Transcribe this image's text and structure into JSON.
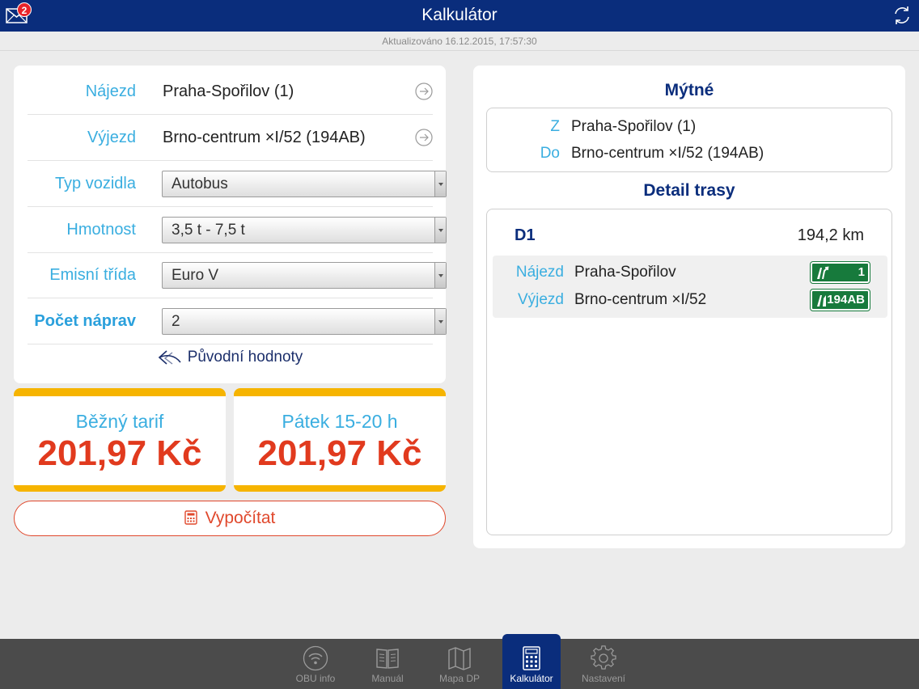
{
  "header": {
    "title": "Kalkulátor",
    "mail_badge": "2",
    "updated": "Aktualizováno 16.12.2015, 17:57:30"
  },
  "form": {
    "entry_label": "Nájezd",
    "entry_value": "Praha-Spořilov (1)",
    "exit_label": "Výjezd",
    "exit_value": "Brno-centrum ×I/52 (194AB)",
    "vehicle_label": "Typ vozidla",
    "vehicle_value": "Autobus",
    "weight_label": "Hmotnost",
    "weight_value": "3,5 t - 7,5 t",
    "emission_label": "Emisní třída",
    "emission_value": "Euro V",
    "axles_label": "Počet náprav",
    "axles_value": "2",
    "reset_label": "Původní hodnoty"
  },
  "tariffs": [
    {
      "name": "Běžný tarif",
      "price": "201,97 Kč"
    },
    {
      "name": "Pátek 15-20 h",
      "price": "201,97 Kč"
    }
  ],
  "calculate_label": "Vypočítat",
  "toll": {
    "title": "Mýtné",
    "from_label": "Z",
    "from_value": "Praha-Spořilov (1)",
    "to_label": "Do",
    "to_value": "Brno-centrum ×I/52 (194AB)"
  },
  "route": {
    "title": "Detail trasy",
    "road": "D1",
    "distance": "194,2 km",
    "entry_label": "Nájezd",
    "entry_value": "Praha-Spořilov",
    "entry_sign": "1",
    "exit_label": "Výjezd",
    "exit_value": "Brno-centrum ×I/52",
    "exit_sign": "194AB"
  },
  "tabs": [
    {
      "label": "OBU info",
      "icon": "wifi-icon"
    },
    {
      "label": "Manuál",
      "icon": "book-icon"
    },
    {
      "label": "Mapa DP",
      "icon": "map-icon"
    },
    {
      "label": "Kalkulátor",
      "icon": "calculator-icon"
    },
    {
      "label": "Nastavení",
      "icon": "gear-icon"
    }
  ],
  "colors": {
    "header": "#0a2d7c",
    "label": "#3aaee0",
    "price": "#e13a1e",
    "tariff_band": "#f6b400",
    "sign": "#177a3c"
  }
}
